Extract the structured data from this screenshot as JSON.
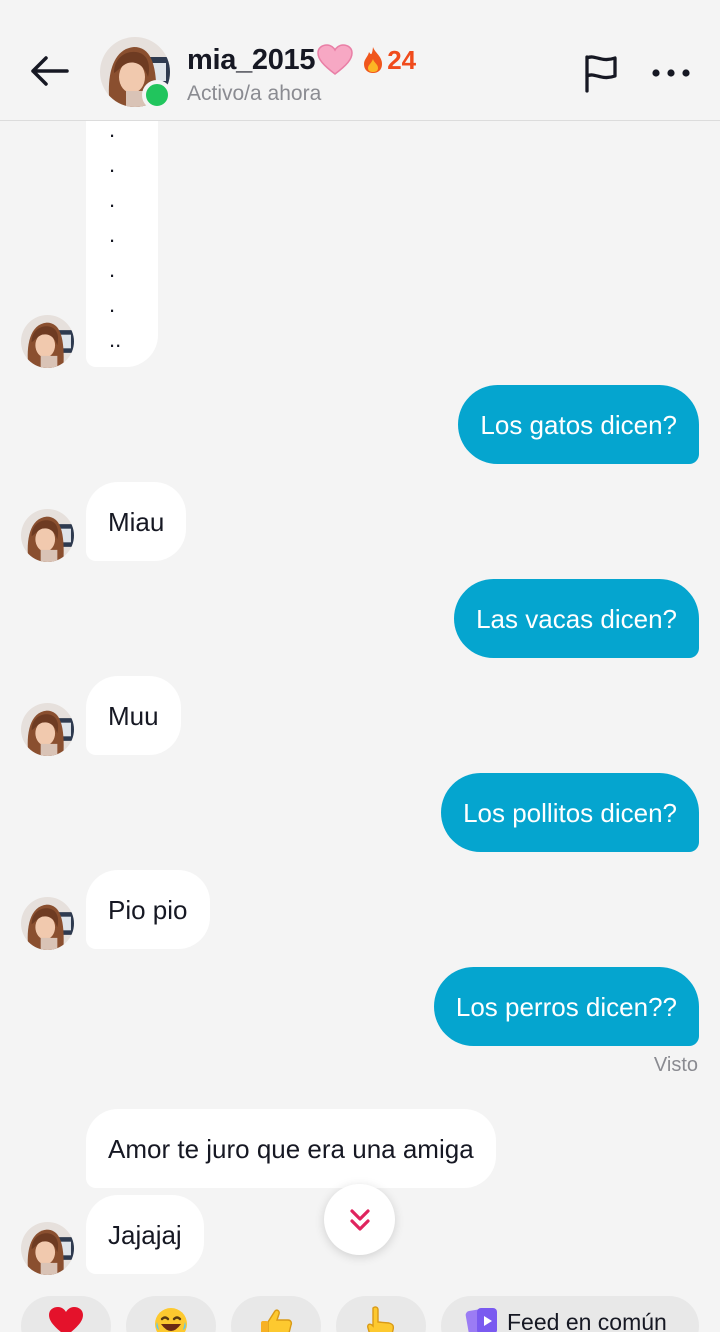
{
  "header": {
    "username": "mia_2015",
    "heart_emoji_icon": "pink-heart",
    "streak_icon": "fire",
    "streak_count": "24",
    "status": "Activo/a ahora",
    "accent_online": "#21c55d",
    "accent_streak": "#f04b1c"
  },
  "messages": {
    "m_dots_last": "..",
    "m1": "Los gatos dicen?",
    "m2": "Miau",
    "m3": "Las vacas dicen?",
    "m4": "Muu",
    "m5": "Los pollitos dicen?",
    "m6": "Pio pio",
    "m7": "Los perros dicen??",
    "m8": "Amor te juro que era una amiga",
    "m9": "Jajajaj"
  },
  "seen_label": "Visto",
  "colors": {
    "outgoing_bubble": "#05a5cf",
    "incoming_bubble": "#ffffff",
    "background": "#f4f4f4"
  },
  "quick_replies": {
    "feed_label": "Feed en común",
    "reactions": [
      "heart",
      "laughing-tears",
      "thumbs-up",
      "pointing-finger"
    ]
  }
}
